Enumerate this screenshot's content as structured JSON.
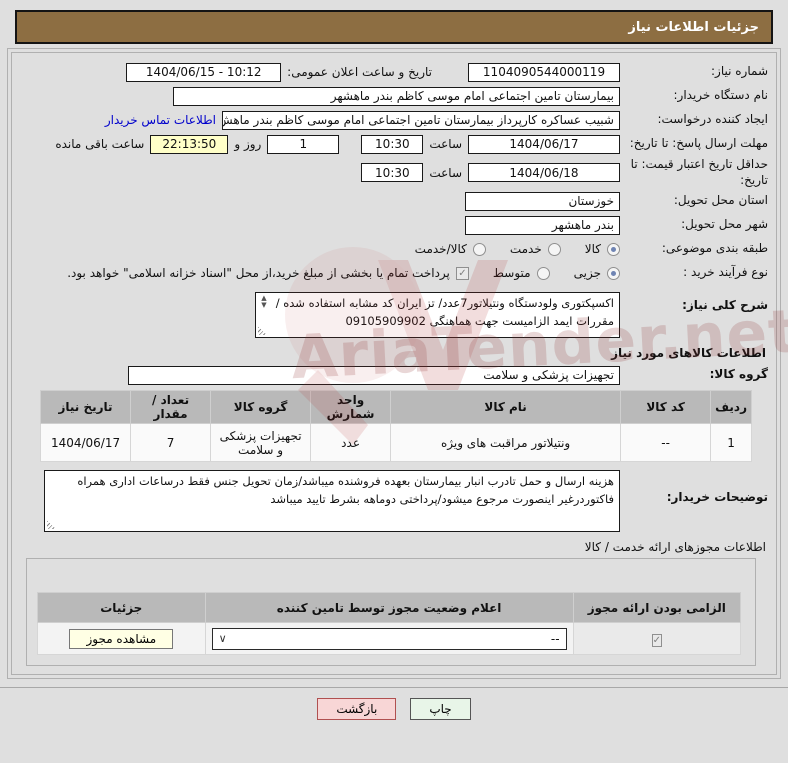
{
  "title_bar": {
    "title": "جزئیات اطلاعات نیاز"
  },
  "icons": {
    "check": "✓",
    "chevron_down": "∨",
    "scroll_up": "▲",
    "scroll_down": "▼"
  },
  "watermark": {
    "text": "AriaTender.net"
  },
  "form": {
    "need_number": {
      "label": "شماره نیاز:",
      "value": "1104090544000119"
    },
    "public_announce": {
      "label": "تاریخ و ساعت اعلان عمومی:",
      "value": "1404/06/15 - 10:12"
    },
    "buyer_org": {
      "label": "نام دستگاه خریدار:",
      "value": "بیمارستان تامین اجتماعی امام موسی کاظم بندر ماهشهر"
    },
    "requester": {
      "label": "ایجاد کننده درخواست:",
      "value": "شبیب عساکره کارپرداز بیمارستان تامین اجتماعی امام موسی کاظم بندر ماهش",
      "contact_link": "اطلاعات تماس خریدار"
    },
    "reply_deadline": {
      "label": "مهلت ارسال پاسخ: تا تاریخ:",
      "date": "1404/06/17",
      "hour_label": "ساعت",
      "time": "10:30",
      "days_value": "1",
      "days_label": "روز و",
      "remaining_time": "22:13:50",
      "remaining_label": "ساعت باقی مانده"
    },
    "price_validity": {
      "label": "حداقل تاریخ اعتبار قیمت: تا تاریخ:",
      "date": "1404/06/18",
      "hour_label": "ساعت",
      "time": "10:30"
    },
    "province": {
      "label": "استان محل تحویل:",
      "value": "خوزستان"
    },
    "city": {
      "label": "شهر محل تحویل:",
      "value": "بندر ماهشهر"
    },
    "subject_class": {
      "label": "طبقه بندی موضوعی:",
      "options": [
        "کالا",
        "خدمت",
        "کالا/خدمت"
      ],
      "selected": "کالا"
    },
    "purchase_process": {
      "label": "نوع فرآیند خرید :",
      "options": [
        "جزیی",
        "متوسط"
      ],
      "selected": "جزیی",
      "treasury_note": "پرداخت تمام یا بخشی از مبلغ خرید،از محل \"اسناد خزانه اسلامی\" خواهد بود.",
      "treasury_checked": true
    },
    "need_description": {
      "label": "شرح کلی نیاز:",
      "value": "اکسپکتوری ولودستگاه ونتیلاتور7عدد/ تز ایران کد مشابه استفاده شده /مقررات ایمد الزامیست جهت هماهنگی 09105909902"
    },
    "buyer_notes": {
      "label": "توضیحات خریدار:",
      "value": "هزینه ارسال و حمل تادرب انبار بیمارستان بعهده فروشنده میباشد/زمان تحویل جنس فقط درساعات اداری همراه فاکتوردرغیر اینصورت مرجوع میشود/پرداختی دوماهه بشرط تایید میباشد"
    }
  },
  "goods_section": {
    "title": "اطلاعات کالاهای مورد نیاز",
    "group": {
      "label": "گروه کالا:",
      "value": "تجهیزات پزشکی و سلامت"
    },
    "table": {
      "headers": [
        "ردیف",
        "کد کالا",
        "نام کالا",
        "واحد شمارش",
        "گروه کالا",
        "تعداد / مقدار",
        "تاریخ نیاز"
      ],
      "rows": [
        [
          "1",
          "--",
          "ونتیلاتور مراقبت های ویژه",
          "عدد",
          "تجهیزات پزشکی و سلامت",
          "7",
          "1404/06/17"
        ]
      ]
    }
  },
  "license_section": {
    "title": "اطلاعات مجوزهای ارائه خدمت / کالا",
    "table": {
      "headers": [
        "الزامی بودن ارائه مجوز",
        "اعلام وضعیت مجوز توسط تامین کننده",
        "جزئیات"
      ],
      "row": {
        "required_checked": true,
        "status_value": "--",
        "details_button": "مشاهده مجوز"
      }
    }
  },
  "footer": {
    "back_button": "بازگشت",
    "print_button": "چاپ"
  }
}
